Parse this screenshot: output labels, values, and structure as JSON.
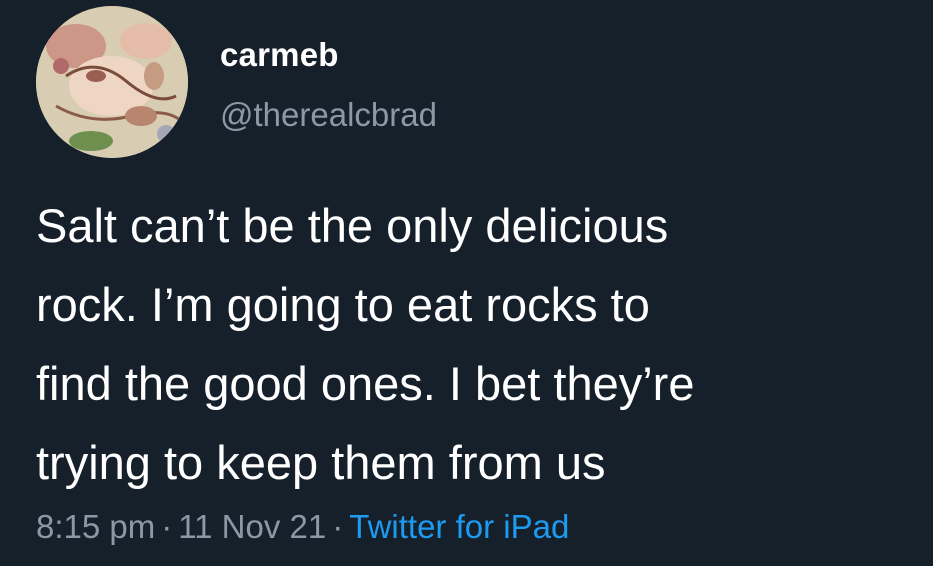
{
  "user": {
    "display_name": "carmeb",
    "handle": "@therealcbrad"
  },
  "tweet": {
    "lines": [
      "Salt can’t be the only delicious",
      "rock. I’m going to eat rocks to",
      "find the good ones. I bet they’re",
      "trying to keep them from us"
    ],
    "time": "8:15 pm",
    "date": "11 Nov 21",
    "source": "Twitter for iPad",
    "separator": "·"
  },
  "colors": {
    "background": "#15202b",
    "text": "#ffffff",
    "secondary": "#8b98a5",
    "link": "#1d9bf0"
  }
}
